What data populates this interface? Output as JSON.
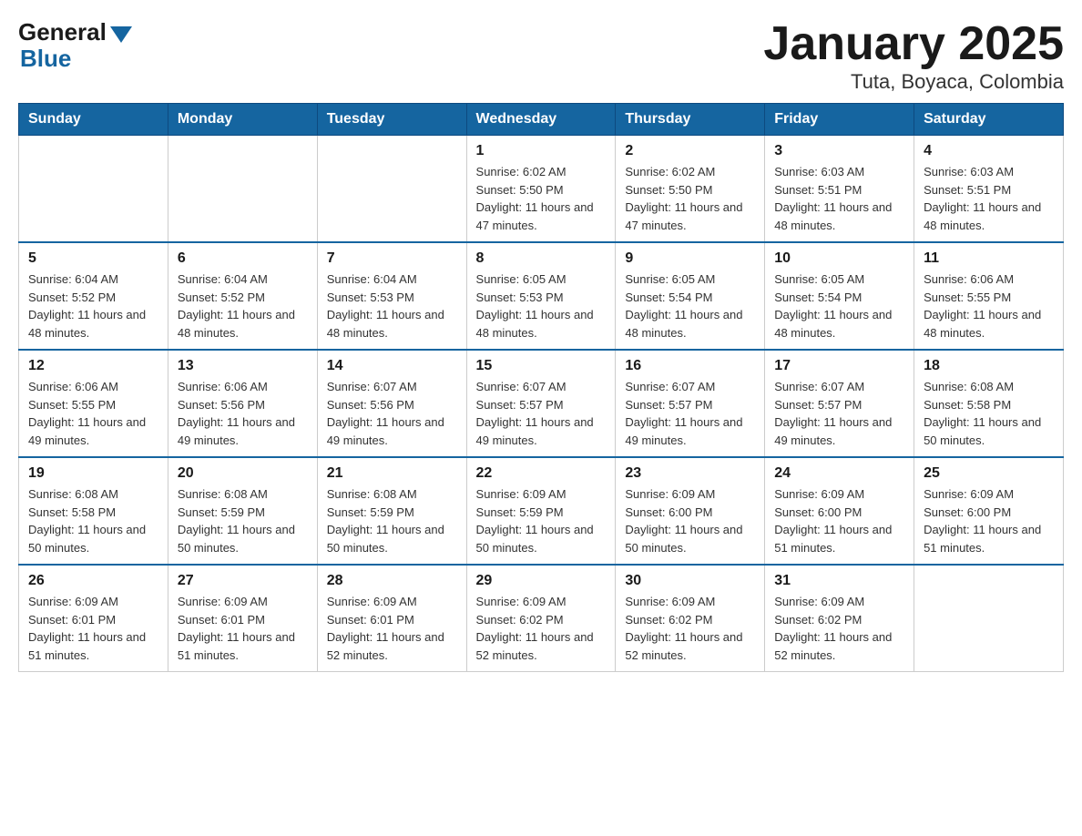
{
  "header": {
    "logo_general": "General",
    "logo_blue": "Blue",
    "month_title": "January 2025",
    "location": "Tuta, Boyaca, Colombia"
  },
  "weekdays": [
    "Sunday",
    "Monday",
    "Tuesday",
    "Wednesday",
    "Thursday",
    "Friday",
    "Saturday"
  ],
  "weeks": [
    [
      {
        "day": "",
        "info": ""
      },
      {
        "day": "",
        "info": ""
      },
      {
        "day": "",
        "info": ""
      },
      {
        "day": "1",
        "info": "Sunrise: 6:02 AM\nSunset: 5:50 PM\nDaylight: 11 hours and 47 minutes."
      },
      {
        "day": "2",
        "info": "Sunrise: 6:02 AM\nSunset: 5:50 PM\nDaylight: 11 hours and 47 minutes."
      },
      {
        "day": "3",
        "info": "Sunrise: 6:03 AM\nSunset: 5:51 PM\nDaylight: 11 hours and 48 minutes."
      },
      {
        "day": "4",
        "info": "Sunrise: 6:03 AM\nSunset: 5:51 PM\nDaylight: 11 hours and 48 minutes."
      }
    ],
    [
      {
        "day": "5",
        "info": "Sunrise: 6:04 AM\nSunset: 5:52 PM\nDaylight: 11 hours and 48 minutes."
      },
      {
        "day": "6",
        "info": "Sunrise: 6:04 AM\nSunset: 5:52 PM\nDaylight: 11 hours and 48 minutes."
      },
      {
        "day": "7",
        "info": "Sunrise: 6:04 AM\nSunset: 5:53 PM\nDaylight: 11 hours and 48 minutes."
      },
      {
        "day": "8",
        "info": "Sunrise: 6:05 AM\nSunset: 5:53 PM\nDaylight: 11 hours and 48 minutes."
      },
      {
        "day": "9",
        "info": "Sunrise: 6:05 AM\nSunset: 5:54 PM\nDaylight: 11 hours and 48 minutes."
      },
      {
        "day": "10",
        "info": "Sunrise: 6:05 AM\nSunset: 5:54 PM\nDaylight: 11 hours and 48 minutes."
      },
      {
        "day": "11",
        "info": "Sunrise: 6:06 AM\nSunset: 5:55 PM\nDaylight: 11 hours and 48 minutes."
      }
    ],
    [
      {
        "day": "12",
        "info": "Sunrise: 6:06 AM\nSunset: 5:55 PM\nDaylight: 11 hours and 49 minutes."
      },
      {
        "day": "13",
        "info": "Sunrise: 6:06 AM\nSunset: 5:56 PM\nDaylight: 11 hours and 49 minutes."
      },
      {
        "day": "14",
        "info": "Sunrise: 6:07 AM\nSunset: 5:56 PM\nDaylight: 11 hours and 49 minutes."
      },
      {
        "day": "15",
        "info": "Sunrise: 6:07 AM\nSunset: 5:57 PM\nDaylight: 11 hours and 49 minutes."
      },
      {
        "day": "16",
        "info": "Sunrise: 6:07 AM\nSunset: 5:57 PM\nDaylight: 11 hours and 49 minutes."
      },
      {
        "day": "17",
        "info": "Sunrise: 6:07 AM\nSunset: 5:57 PM\nDaylight: 11 hours and 49 minutes."
      },
      {
        "day": "18",
        "info": "Sunrise: 6:08 AM\nSunset: 5:58 PM\nDaylight: 11 hours and 50 minutes."
      }
    ],
    [
      {
        "day": "19",
        "info": "Sunrise: 6:08 AM\nSunset: 5:58 PM\nDaylight: 11 hours and 50 minutes."
      },
      {
        "day": "20",
        "info": "Sunrise: 6:08 AM\nSunset: 5:59 PM\nDaylight: 11 hours and 50 minutes."
      },
      {
        "day": "21",
        "info": "Sunrise: 6:08 AM\nSunset: 5:59 PM\nDaylight: 11 hours and 50 minutes."
      },
      {
        "day": "22",
        "info": "Sunrise: 6:09 AM\nSunset: 5:59 PM\nDaylight: 11 hours and 50 minutes."
      },
      {
        "day": "23",
        "info": "Sunrise: 6:09 AM\nSunset: 6:00 PM\nDaylight: 11 hours and 50 minutes."
      },
      {
        "day": "24",
        "info": "Sunrise: 6:09 AM\nSunset: 6:00 PM\nDaylight: 11 hours and 51 minutes."
      },
      {
        "day": "25",
        "info": "Sunrise: 6:09 AM\nSunset: 6:00 PM\nDaylight: 11 hours and 51 minutes."
      }
    ],
    [
      {
        "day": "26",
        "info": "Sunrise: 6:09 AM\nSunset: 6:01 PM\nDaylight: 11 hours and 51 minutes."
      },
      {
        "day": "27",
        "info": "Sunrise: 6:09 AM\nSunset: 6:01 PM\nDaylight: 11 hours and 51 minutes."
      },
      {
        "day": "28",
        "info": "Sunrise: 6:09 AM\nSunset: 6:01 PM\nDaylight: 11 hours and 52 minutes."
      },
      {
        "day": "29",
        "info": "Sunrise: 6:09 AM\nSunset: 6:02 PM\nDaylight: 11 hours and 52 minutes."
      },
      {
        "day": "30",
        "info": "Sunrise: 6:09 AM\nSunset: 6:02 PM\nDaylight: 11 hours and 52 minutes."
      },
      {
        "day": "31",
        "info": "Sunrise: 6:09 AM\nSunset: 6:02 PM\nDaylight: 11 hours and 52 minutes."
      },
      {
        "day": "",
        "info": ""
      }
    ]
  ]
}
